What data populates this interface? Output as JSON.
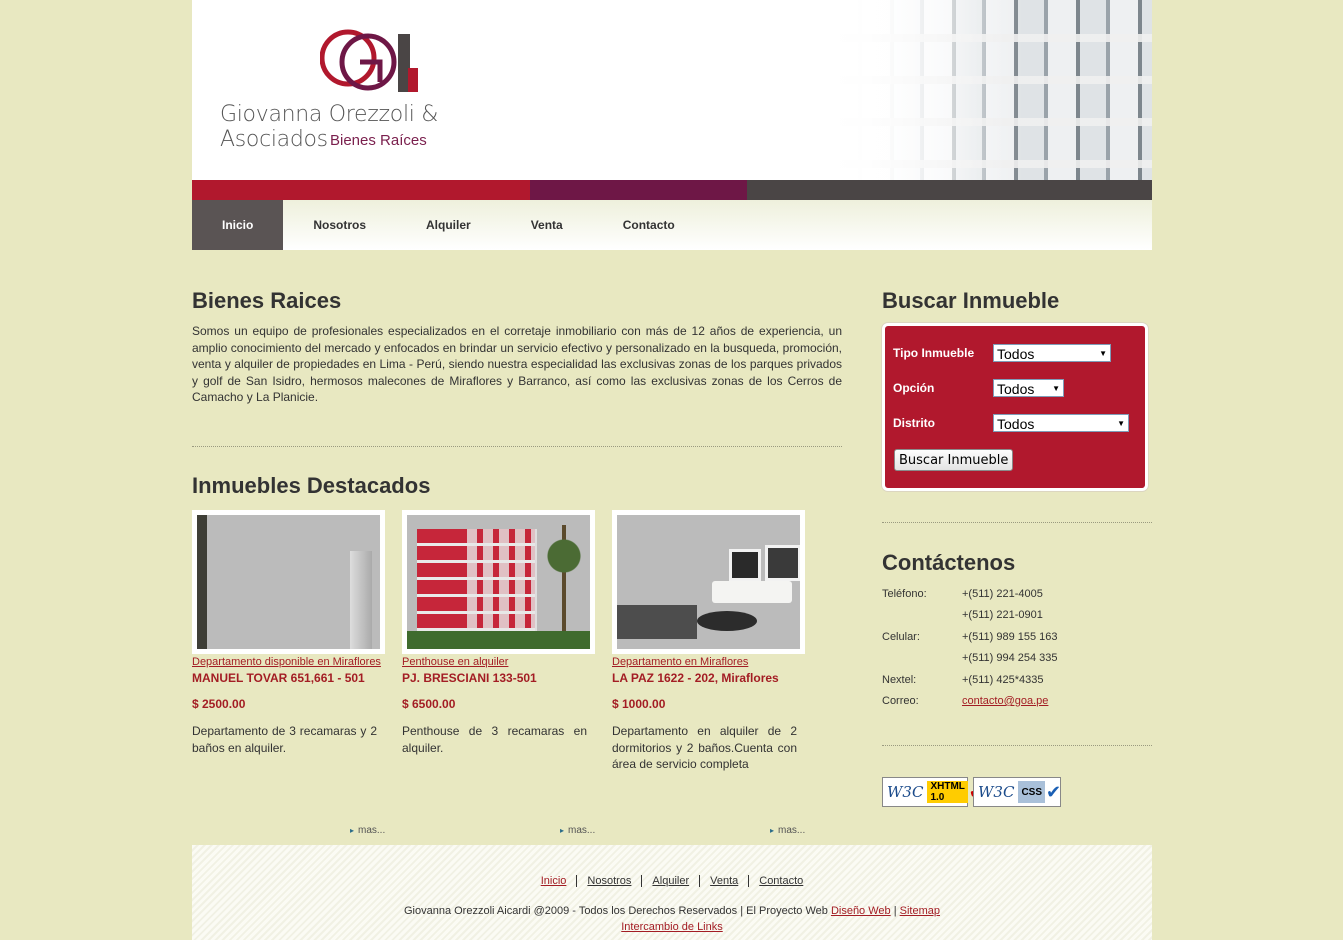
{
  "brand": {
    "name": "Giovanna Orezzoli & Asociados",
    "tagline": "Bienes Raíces"
  },
  "nav": {
    "items": [
      "Inicio",
      "Nosotros",
      "Alquiler",
      "Venta",
      "Contacto"
    ],
    "active": "Inicio"
  },
  "intro": {
    "title": "Bienes Raices",
    "text": "Somos un equipo de profesionales especializados en el corretaje inmobiliario con más de 12 años de experiencia, un amplio conocimiento del mercado y enfocados en brindar un servicio efectivo y personalizado en la busqueda, promoción, venta y alquiler de propiedades en Lima - Perú, siendo nuestra especialidad las exclusivas zonas de los parques privados y golf de San Isidro, hermosos malecones de Miraflores y Barranco, así como las exclusivas zonas de los Cerros de Camacho y La Planicie."
  },
  "featured": {
    "title": "Inmuebles Destacados",
    "more_label": "mas...",
    "properties": [
      {
        "link": "Departamento disponible en Miraflores",
        "address": "MANUEL TOVAR 651,661 - 501",
        "price": "$ 2500.00",
        "description": "Departamento de 3 recamaras y 2 baños en alquiler."
      },
      {
        "link": "Penthouse en alquiler",
        "address": "PJ. BRESCIANI 133-501",
        "price": "$ 6500.00",
        "description": "Penthouse de 3 recamaras en alquiler."
      },
      {
        "link": "Departamento en Miraflores",
        "address": "LA PAZ 1622 - 202, Miraflores",
        "price": "$ 1000.00",
        "description": "Departamento en alquiler de 2 dormitorios y 2 baños.Cuenta con área de servicio completa"
      }
    ]
  },
  "search": {
    "title": "Buscar Inmueble",
    "fields": [
      {
        "label": "Tipo Inmueble",
        "value": "Todos"
      },
      {
        "label": "Opción",
        "value": "Todos"
      },
      {
        "label": "Distrito",
        "value": "Todos"
      }
    ],
    "button": "Buscar Inmueble"
  },
  "contact": {
    "title": "Contáctenos",
    "phone_label": "Teléfono:",
    "phone1": "+(511) 221-4005",
    "phone2": "+(511) 221-0901",
    "cell_label": "Celular:",
    "cell1": "+(511) 989 155 163",
    "cell2": "+(511) 994 254 335",
    "nextel_label": "Nextel:",
    "nextel": "+(511) 425*4335",
    "email_label": "Correo:",
    "email": "contacto@goa.pe"
  },
  "badges": {
    "xhtml": "XHTML 1.0",
    "css": "CSS",
    "w3c": "W3C"
  },
  "footer": {
    "links": [
      "Inicio",
      "Nosotros",
      "Alquiler",
      "Venta",
      "Contacto"
    ],
    "copyright": "Giovanna Orezzoli Aicardi @2009 - Todos los Derechos Reservados | El Proyecto Web",
    "design_link": "Diseño Web",
    "separator": "|",
    "sitemap": "Sitemap",
    "exchange": "Intercambio de Links"
  },
  "colors": {
    "background": "#e8e8c1",
    "accent_red": "#b1182d",
    "accent_plum": "#6e1746",
    "dark_gray": "#4a4545",
    "link_red": "#a31d24"
  }
}
